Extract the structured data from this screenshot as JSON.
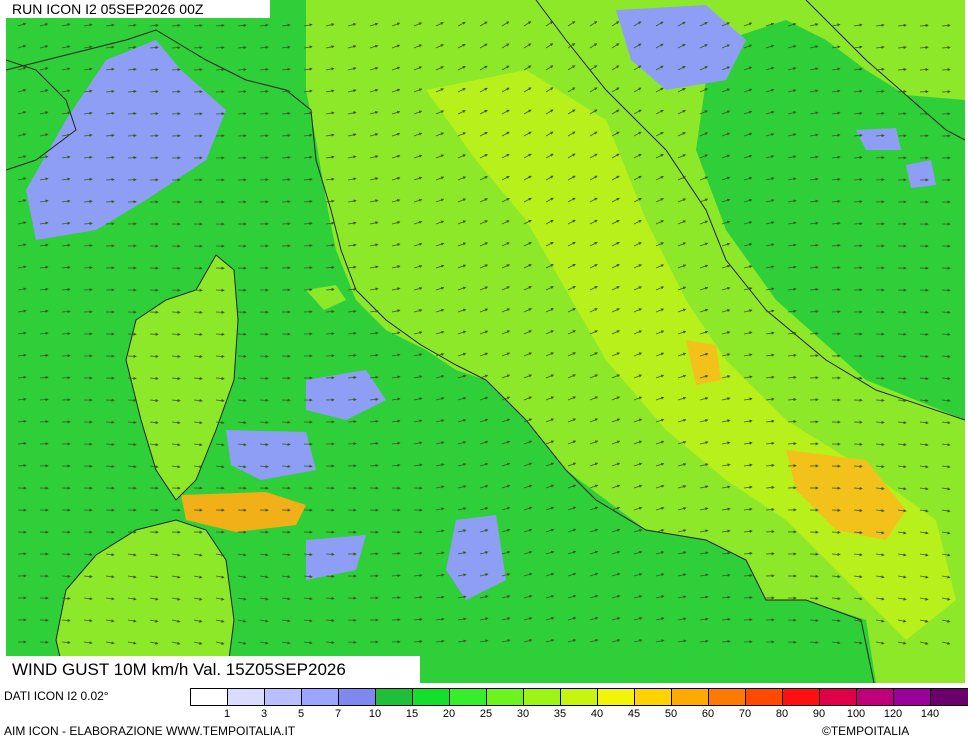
{
  "header": {
    "run_title": "RUN ICON I2 05SEP2026 00Z"
  },
  "footer": {
    "product_title": "WIND GUST 10M km/h Val. 15Z05SEP2026",
    "data_source": "DATI ICON I2 0.02°",
    "credit_left": "AIM ICON - ELABORAZIONE WWW.TEMPOITALIA.IT",
    "credit_right": "©TEMPOITALIA"
  },
  "legend": {
    "unit": "km/h",
    "bins": [
      {
        "color": "#ffffff",
        "label": "1"
      },
      {
        "color": "#d9dcff",
        "label": "3"
      },
      {
        "color": "#b9c0ff",
        "label": "5"
      },
      {
        "color": "#9aa6ff",
        "label": "7"
      },
      {
        "color": "#7f88ee",
        "label": "10"
      },
      {
        "color": "#1fbf3a",
        "label": "15"
      },
      {
        "color": "#13e02a",
        "label": "20"
      },
      {
        "color": "#35ef2d",
        "label": "25"
      },
      {
        "color": "#6cf51d",
        "label": "30"
      },
      {
        "color": "#9df515",
        "label": "35"
      },
      {
        "color": "#c8f50f",
        "label": "40"
      },
      {
        "color": "#f2f50a",
        "label": "45"
      },
      {
        "color": "#ffd200",
        "label": "50"
      },
      {
        "color": "#ffaa00",
        "label": "60"
      },
      {
        "color": "#ff7a00",
        "label": "70"
      },
      {
        "color": "#ff4a00",
        "label": "80"
      },
      {
        "color": "#ff1010",
        "label": "90"
      },
      {
        "color": "#e0004a",
        "label": "100"
      },
      {
        "color": "#c0007a",
        "label": "120"
      },
      {
        "color": "#9a009a",
        "label": "140"
      },
      {
        "color": "#6a006a",
        "label": ""
      }
    ]
  },
  "map": {
    "sea_color": "#2fcf3a",
    "land_color": "#8ee82a",
    "calm_color": "#8f9ef5",
    "strong_color": "#f2b018",
    "coastline_color": "#222222",
    "arrow_color": "#3a5a1a"
  }
}
